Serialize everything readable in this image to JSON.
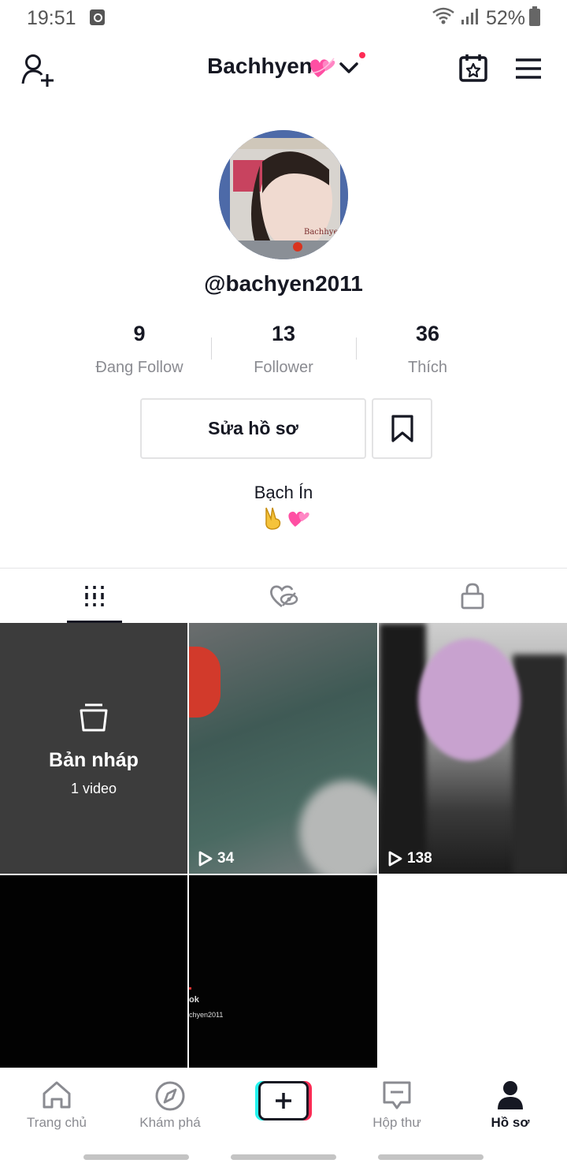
{
  "status_bar": {
    "time": "19:51",
    "battery": "52%"
  },
  "header": {
    "username": "Bachhyen"
  },
  "profile": {
    "handle": "@bachyen2011",
    "stats": [
      {
        "value": "9",
        "label": "Đang Follow"
      },
      {
        "value": "13",
        "label": "Follower"
      },
      {
        "value": "36",
        "label": "Thích"
      }
    ],
    "edit_button": "Sửa hồ sơ",
    "bio_name": "Bạch Ín"
  },
  "avatar_watermark": "Bachhyen",
  "grid": {
    "drafts_title": "Bản nháp",
    "drafts_count": "1 video",
    "videos": [
      {
        "plays": "34"
      },
      {
        "plays": "138"
      }
    ],
    "watermark_line1": "ok",
    "watermark_line2": "chyen2011"
  },
  "bottom_nav": {
    "home": "Trang chủ",
    "discover": "Khám phá",
    "inbox": "Hộp thư",
    "profile": "Hồ sơ"
  },
  "colors": {
    "accent_pink": "#fe2c55",
    "accent_cyan": "#25f4ee",
    "text_primary": "#161823",
    "text_secondary": "#8a8b91"
  }
}
